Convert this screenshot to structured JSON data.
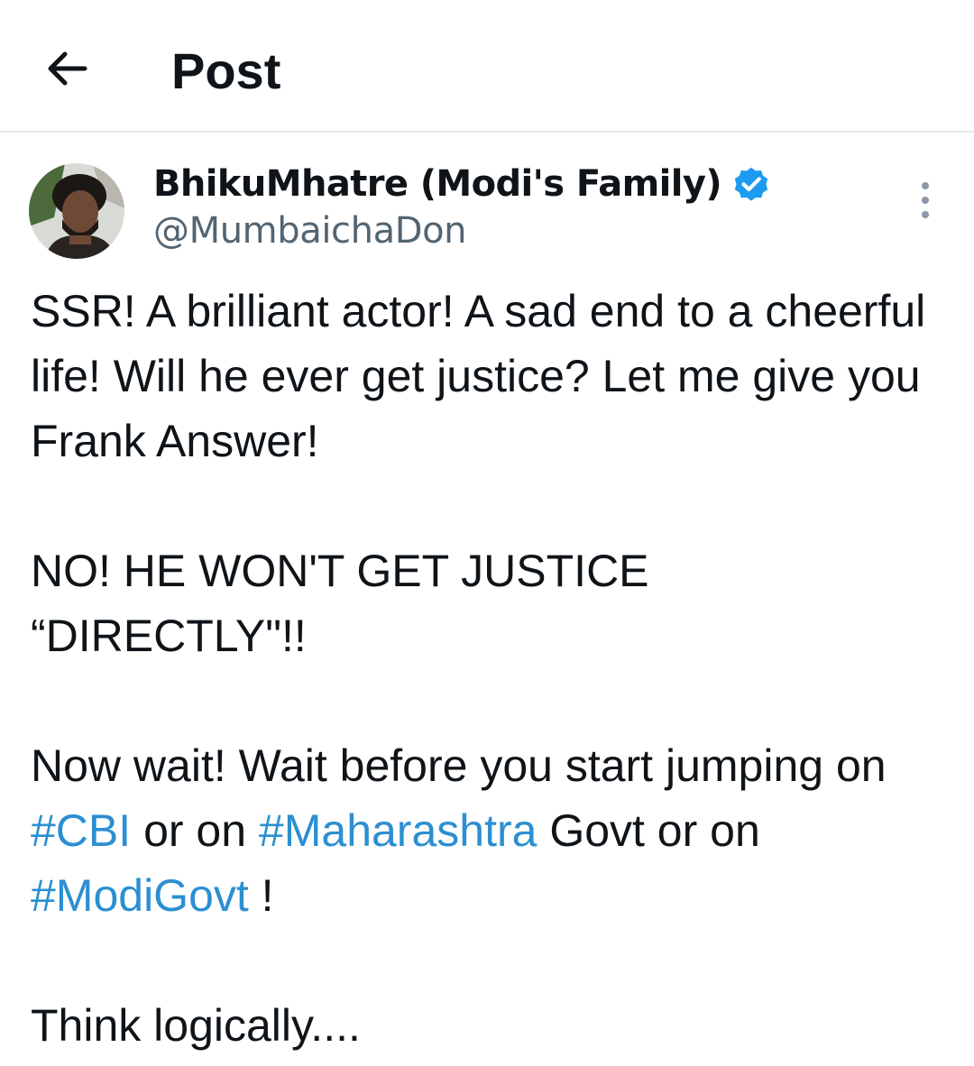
{
  "header": {
    "title": "Post",
    "back_icon": "arrow-left-icon"
  },
  "author": {
    "display_name": "BhikuMhatre (Modi's Family)",
    "handle": "@MumbaichaDon",
    "verified_icon": "verified-badge-icon",
    "verified_color": "#1d9bf0",
    "avatar_icon": "avatar"
  },
  "more_icon": "more-vertical-icon",
  "tweet": {
    "line1": "SSR! A brilliant actor! A sad end to a cheerful life! Will he ever get justice? Let me give you Frank Answer!",
    "line2a": "NO! HE WON'T GET JUSTICE",
    "line2b": "“DIRECTLY\"!!",
    "p3_text1": "Now wait! Wait before you start jumping on ",
    "hashtag1": "#CBI",
    "p3_text2": " or on ",
    "hashtag2": "#Maharashtra",
    "p3_text3": " Govt or on ",
    "hashtag3": "#ModiGovt",
    "p3_text4": " !",
    "line4": "Think logically...."
  },
  "colors": {
    "text": "#0f1419",
    "secondary": "#536471",
    "link": "#2b8fd1",
    "divider": "#e6e9ec"
  }
}
